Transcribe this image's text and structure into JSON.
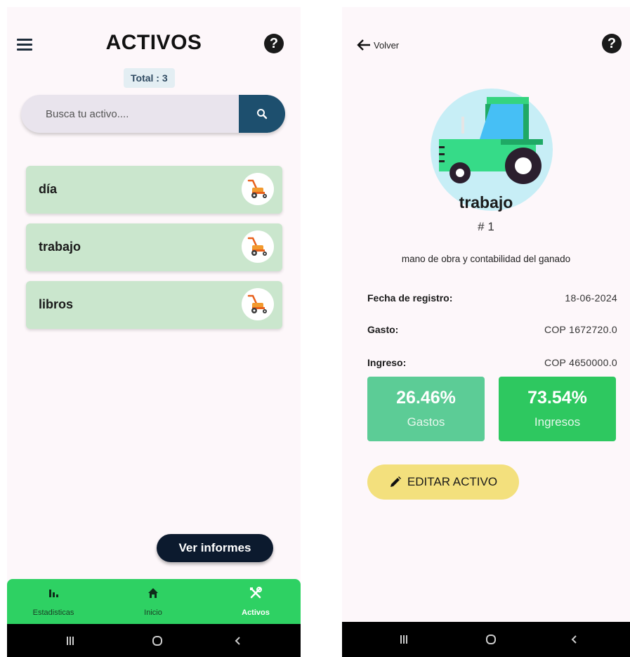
{
  "list_screen": {
    "title": "ACTIVOS",
    "total_label": "Total : 3",
    "search": {
      "placeholder": "Busca tu activo...."
    },
    "assets": [
      {
        "label": "día"
      },
      {
        "label": "trabajo"
      },
      {
        "label": "libros"
      }
    ],
    "reports_button": "Ver informes",
    "bottom_nav": [
      {
        "label": "Estadisticas",
        "icon": "bar-chart-icon"
      },
      {
        "label": "Inicio",
        "icon": "home-icon"
      },
      {
        "label": "Activos",
        "icon": "tools-icon",
        "active": true
      }
    ]
  },
  "detail_screen": {
    "back_label": "Volver",
    "asset_name": "trabajo",
    "asset_number": "# 1",
    "description": "mano de obra y contabilidad del ganado",
    "fields": {
      "date_label": "Fecha de registro:",
      "date_value": "18-06-2024",
      "expense_label": "Gasto:",
      "expense_value": "COP 1672720.0",
      "income_label": "Ingreso:",
      "income_value": "COP 4650000.0"
    },
    "stats": {
      "expenses_pct": "26.46%",
      "expenses_caption": "Gastos",
      "income_pct": "73.54%",
      "income_caption": "Ingresos"
    },
    "edit_button": "EDITAR ACTIVO"
  },
  "system_nav": {
    "recents": "|||",
    "home": "○",
    "back": "‹"
  },
  "colors": {
    "nav_green": "#2ed163",
    "asset_card": "#cae6cd",
    "search_button": "#1d4f6e",
    "expense_box": "#5ccc96",
    "income_box": "#2ec860",
    "edit_button": "#f3e07d",
    "reports_button": "#0c1a2e"
  }
}
